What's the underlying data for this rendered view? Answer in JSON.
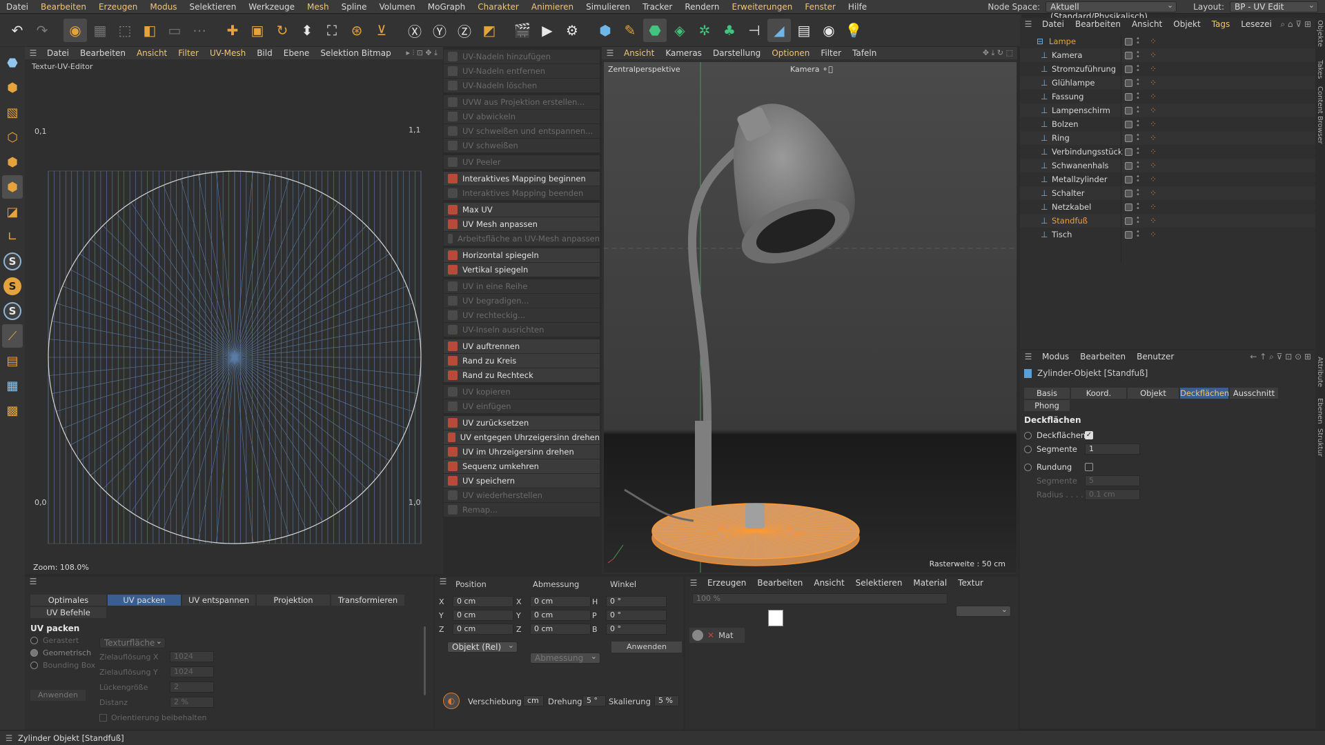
{
  "menubar": {
    "items": [
      "Datei",
      "Bearbeiten",
      "Erzeugen",
      "Modus",
      "Selektieren",
      "Werkzeuge",
      "Mesh",
      "Spline",
      "Volumen",
      "MoGraph",
      "Charakter",
      "Animieren",
      "Simulieren",
      "Tracker",
      "Rendern",
      "Erweiterungen",
      "Fenster",
      "Hilfe"
    ],
    "node_space_label": "Node Space:",
    "node_space_value": "Aktuell (Standard/Physikalisch)",
    "layout_label": "Layout:",
    "layout_value": "BP - UV Edit"
  },
  "uv_editor": {
    "menu": [
      "Datei",
      "Bearbeiten",
      "Ansicht",
      "Filter",
      "UV-Mesh",
      "Bild",
      "Ebene",
      "Selektion Bitmap"
    ],
    "title": "Textur-UV-Editor",
    "corner_tl": "0,1",
    "corner_tr": "1,1",
    "corner_bl": "0,0",
    "corner_br": "1,0",
    "zoom": "Zoom: 108.0%"
  },
  "uv_commands": [
    {
      "label": "UV-Nadeln hinzufügen",
      "enabled": false
    },
    {
      "label": "UV-Nadeln entfernen",
      "enabled": false
    },
    {
      "label": "UV-Nadeln löschen",
      "enabled": false
    },
    {
      "label": "UVW aus Projektion erstellen...",
      "enabled": false
    },
    {
      "label": "UV abwickeln",
      "enabled": false
    },
    {
      "label": "UV schweißen und entspannen...",
      "enabled": false
    },
    {
      "label": "UV schweißen",
      "enabled": false
    },
    {
      "label": "UV Peeler",
      "enabled": false
    },
    {
      "label": "Interaktives Mapping beginnen",
      "enabled": true
    },
    {
      "label": "Interaktives Mapping beenden",
      "enabled": false
    },
    {
      "label": "Max UV",
      "enabled": true
    },
    {
      "label": "UV Mesh anpassen",
      "enabled": true
    },
    {
      "label": "Arbeitsfläche an UV-Mesh anpassen",
      "enabled": false
    },
    {
      "label": "Horizontal spiegeln",
      "enabled": true
    },
    {
      "label": "Vertikal spiegeln",
      "enabled": true
    },
    {
      "label": "UV in eine Reihe",
      "enabled": false
    },
    {
      "label": "UV begradigen...",
      "enabled": false
    },
    {
      "label": "UV rechteckig...",
      "enabled": false
    },
    {
      "label": "UV-Inseln ausrichten",
      "enabled": false
    },
    {
      "label": "UV auftrennen",
      "enabled": true
    },
    {
      "label": "Rand zu Kreis",
      "enabled": true
    },
    {
      "label": "Rand zu Rechteck",
      "enabled": true
    },
    {
      "label": "UV kopieren",
      "enabled": false
    },
    {
      "label": "UV einfügen",
      "enabled": false
    },
    {
      "label": "UV zurücksetzen",
      "enabled": true
    },
    {
      "label": "UV entgegen Uhrzeigersinn drehen",
      "enabled": true
    },
    {
      "label": "UV im Uhrzeigersinn drehen",
      "enabled": true
    },
    {
      "label": "Sequenz umkehren",
      "enabled": true
    },
    {
      "label": "UV speichern",
      "enabled": true
    },
    {
      "label": "UV wiederherstellen",
      "enabled": false
    },
    {
      "label": "Remap...",
      "enabled": false
    }
  ],
  "viewport": {
    "menu": [
      "Ansicht",
      "Kameras",
      "Darstellung",
      "Optionen",
      "Filter",
      "Tafeln"
    ],
    "perspective": "Zentralperspektive",
    "camera": "Kamera",
    "raster": "Rasterweite : 50 cm"
  },
  "object_manager": {
    "menu": [
      "Datei",
      "Bearbeiten",
      "Ansicht",
      "Objekt",
      "Tags",
      "Lesezei"
    ],
    "objects": [
      {
        "name": "Lampe",
        "level": 0,
        "selected": true
      },
      {
        "name": "Kamera",
        "level": 1
      },
      {
        "name": "Stromzuführung",
        "level": 1
      },
      {
        "name": "Glühlampe",
        "level": 1
      },
      {
        "name": "Fassung",
        "level": 1
      },
      {
        "name": "Lampenschirm",
        "level": 1
      },
      {
        "name": "Bolzen",
        "level": 1
      },
      {
        "name": "Ring",
        "level": 1
      },
      {
        "name": "Verbindungsstück",
        "level": 1
      },
      {
        "name": "Schwanenhals",
        "level": 1
      },
      {
        "name": "Metallzylinder",
        "level": 1
      },
      {
        "name": "Schalter",
        "level": 1
      },
      {
        "name": "Netzkabel",
        "level": 1
      },
      {
        "name": "Standfuß",
        "level": 1,
        "selected": true
      },
      {
        "name": "Tisch",
        "level": 1
      }
    ]
  },
  "attributes": {
    "menu": [
      "Modus",
      "Bearbeiten",
      "Benutzer"
    ],
    "object_title": "Zylinder-Objekt [Standfuß]",
    "tabs": [
      "Basis",
      "Koord.",
      "Objekt",
      "Deckflächen",
      "Ausschnitt",
      "Phong"
    ],
    "active_tab": "Deckflächen",
    "section": "Deckflächen",
    "fields": {
      "deckflaechen_label": "Deckflächen",
      "segmente_label": "Segmente",
      "segmente_value": "1",
      "rundung_label": "Rundung",
      "segmente2_label": "Segmente",
      "segmente2_value": "5",
      "radius_label": "Radius . . . .",
      "radius_value": "0.1 cm"
    }
  },
  "right_strip": [
    "Objekte",
    "Takes",
    "Content Browser",
    "Attribute",
    "Ebenen",
    "Struktur"
  ],
  "uv_pack_panel": {
    "tabs": [
      "Optimales Mapping",
      "UV packen",
      "UV entspannen",
      "Projektion",
      "Transformieren",
      "UV Befehle"
    ],
    "active_tab": "UV packen",
    "section": "UV packen",
    "options": [
      "Gerastert",
      "Geometrisch",
      "Bounding Box"
    ],
    "texturflaeche": "Texturfläche",
    "aufl_x_label": "Zielauflösung X",
    "aufl_x_value": "1024",
    "aufl_y_label": "Zielauflösung Y",
    "aufl_y_value": "1024",
    "luecke_label": "Lückengröße",
    "luecke_value": "2",
    "distanz_label": "Distanz",
    "distanz_value": "2 %",
    "orient_label": "Orientierung beibehalten",
    "apply": "Anwenden"
  },
  "coords_panel": {
    "headers": [
      "Position",
      "Abmessung",
      "Winkel"
    ],
    "rows": [
      {
        "a": "X",
        "av": "0 cm",
        "b": "X",
        "bv": "0 cm",
        "c": "H",
        "cv": "0 °"
      },
      {
        "a": "Y",
        "av": "0 cm",
        "b": "Y",
        "bv": "0 cm",
        "c": "P",
        "cv": "0 °"
      },
      {
        "a": "Z",
        "av": "0 cm",
        "b": "Z",
        "bv": "0 cm",
        "c": "B",
        "cv": "0 °"
      }
    ],
    "mode": "Objekt (Rel)",
    "size_mode": "Abmessung",
    "apply": "Anwenden",
    "verschiebung_label": "Verschiebung",
    "verschiebung_unit": "cm",
    "drehung_label": "Drehung",
    "drehung_value": "5 °",
    "skalierung_label": "Skalierung",
    "skalierung_value": "5 %"
  },
  "material_panel": {
    "menu": [
      "Erzeugen",
      "Bearbeiten",
      "Ansicht",
      "Selektieren",
      "Material",
      "Textur"
    ],
    "zoom": "100 %",
    "material_name": "Mat"
  },
  "status": "Zylinder Objekt [Standfuß]",
  "colors": {
    "accent": "#f0c674",
    "selection_orange": "#e6a33c",
    "tab_active": "#3a5e8e",
    "uv_line": "#5b7ea8"
  }
}
